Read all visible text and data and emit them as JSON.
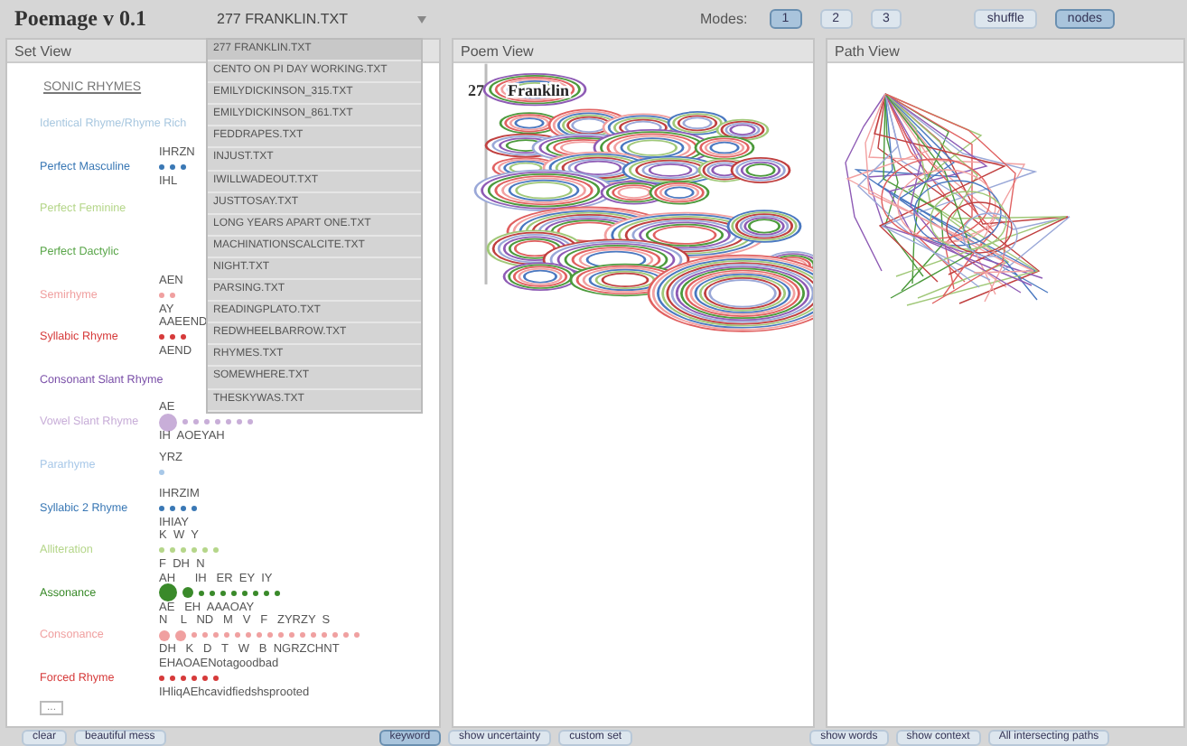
{
  "app": {
    "title": "Poemage v 0.1"
  },
  "file_select": {
    "value": "277 FRANKLIN.TXT",
    "options": [
      {
        "label": "277 FRANKLIN.TXT",
        "selected": true
      },
      {
        "label": "CENTO ON PI DAY WORKING.TXT",
        "selected": false
      },
      {
        "label": "EMILYDICKINSON_315.TXT",
        "selected": false
      },
      {
        "label": "EMILYDICKINSON_861.TXT",
        "selected": false
      },
      {
        "label": "FEDDRAPES.TXT",
        "selected": false
      },
      {
        "label": "INJUST.TXT",
        "selected": false
      },
      {
        "label": "IWILLWADEOUT.TXT",
        "selected": false
      },
      {
        "label": "JUSTTOSAY.TXT",
        "selected": false
      },
      {
        "label": "LONG YEARS APART ONE.TXT",
        "selected": false
      },
      {
        "label": "MACHINATIONSCALCITE.TXT",
        "selected": false
      },
      {
        "label": "NIGHT.TXT",
        "selected": false
      },
      {
        "label": "PARSING.TXT",
        "selected": false
      },
      {
        "label": "READINGPLATO.TXT",
        "selected": false
      },
      {
        "label": "REDWHEELBARROW.TXT",
        "selected": false
      },
      {
        "label": "RHYMES.TXT",
        "selected": false
      },
      {
        "label": "SOMEWHERE.TXT",
        "selected": false
      },
      {
        "label": "THESKYWAS.TXT",
        "selected": false
      }
    ]
  },
  "modes": {
    "label": "Modes:",
    "options": [
      {
        "label": "1",
        "selected": true
      },
      {
        "label": "2",
        "selected": false
      },
      {
        "label": "3",
        "selected": false
      }
    ]
  },
  "toggles": [
    {
      "label": "shuffle",
      "on": false
    },
    {
      "label": "nodes",
      "on": true
    }
  ],
  "set_view": {
    "title": "Set View",
    "heading": "SONIC RHYMES",
    "more": "...",
    "rhymes": [
      {
        "name": "Identical Rhyme/Rhyme Rich",
        "color": "#a9c8e0"
      },
      {
        "name": "Perfect Masculine",
        "color": "#3a78b5",
        "above": "IHRZN",
        "below": "IHL",
        "dots": [
          {
            "kind": "small"
          },
          {
            "kind": "small"
          },
          {
            "kind": "small"
          }
        ]
      },
      {
        "name": "Perfect Feminine",
        "color": "#b5d68a"
      },
      {
        "name": "Perfect Dactylic",
        "color": "#5aa64a"
      },
      {
        "name": "Semirhyme",
        "color": "#f0a0a0",
        "above": "AEN",
        "below": "AY",
        "dots": [
          {
            "kind": "small"
          },
          {
            "kind": "small"
          }
        ]
      },
      {
        "name": "Syllabic Rhyme",
        "color": "#d63a3a",
        "above": "AAEEND",
        "below": "AEND",
        "dots": [
          {
            "kind": "small"
          },
          {
            "kind": "small"
          },
          {
            "kind": "small"
          }
        ]
      },
      {
        "name": "Consonant Slant Rhyme",
        "color": "#7a4fa8"
      },
      {
        "name": "Vowel Slant Rhyme",
        "color": "#c8aed8",
        "above": "AE",
        "below": "IH  AOEYAH",
        "dots": [
          {
            "kind": "large"
          },
          {
            "kind": "small"
          },
          {
            "kind": "small"
          },
          {
            "kind": "small"
          },
          {
            "kind": "small"
          },
          {
            "kind": "small"
          },
          {
            "kind": "small"
          },
          {
            "kind": "small"
          }
        ]
      },
      {
        "name": "Pararhyme",
        "color": "#a8c8e8",
        "above": "YRZ",
        "dots": [
          {
            "kind": "small"
          }
        ]
      },
      {
        "name": "Syllabic 2 Rhyme",
        "color": "#3a78b5",
        "above": "IHRZIM",
        "below": "IHIAY",
        "dots": [
          {
            "kind": "small"
          },
          {
            "kind": "small"
          },
          {
            "kind": "small"
          },
          {
            "kind": "small"
          }
        ]
      },
      {
        "name": "Alliteration",
        "color": "#b5d68a",
        "above": "K  W  Y",
        "below": "F  DH  N",
        "dots": [
          {
            "kind": "small"
          },
          {
            "kind": "small"
          },
          {
            "kind": "small"
          },
          {
            "kind": "small"
          },
          {
            "kind": "small"
          },
          {
            "kind": "small"
          }
        ]
      },
      {
        "name": "Assonance",
        "color": "#3a8a2a",
        "above": "AH      IH   ER  EY  IY",
        "below": "AE   EH  AAAOAY",
        "dots": [
          {
            "kind": "large"
          },
          {
            "kind": "medium"
          },
          {
            "kind": "small"
          },
          {
            "kind": "small"
          },
          {
            "kind": "small"
          },
          {
            "kind": "small"
          },
          {
            "kind": "small"
          },
          {
            "kind": "small"
          },
          {
            "kind": "small"
          },
          {
            "kind": "small"
          }
        ]
      },
      {
        "name": "Consonance",
        "color": "#f0a0a0",
        "above": "N    L   ND   M   V   F   ZYRZY  S",
        "below": "DH   K   D   T   W   B  NGRZCHNT",
        "dots": [
          {
            "kind": "medium"
          },
          {
            "kind": "medium"
          },
          {
            "kind": "small"
          },
          {
            "kind": "small"
          },
          {
            "kind": "small"
          },
          {
            "kind": "small"
          },
          {
            "kind": "small"
          },
          {
            "kind": "small"
          },
          {
            "kind": "small"
          },
          {
            "kind": "small"
          },
          {
            "kind": "small"
          },
          {
            "kind": "small"
          },
          {
            "kind": "small"
          },
          {
            "kind": "small"
          },
          {
            "kind": "small"
          },
          {
            "kind": "small"
          },
          {
            "kind": "small"
          },
          {
            "kind": "small"
          }
        ]
      },
      {
        "name": "Forced Rhyme",
        "color": "#d63a3a",
        "above": "EHAOAENotagoodbad",
        "below": "IHliqAEhcavidfiedshsprooted",
        "dots": [
          {
            "kind": "small"
          },
          {
            "kind": "small"
          },
          {
            "kind": "small"
          },
          {
            "kind": "small"
          },
          {
            "kind": "small"
          },
          {
            "kind": "small"
          }
        ]
      }
    ]
  },
  "poem_view": {
    "title": "Poem View",
    "number": "27",
    "word": "Franklin"
  },
  "path_view": {
    "title": "Path View"
  },
  "bottom_buttons": [
    {
      "label": "clear",
      "selected": false
    },
    {
      "label": "beautiful mess",
      "selected": false
    },
    {
      "label": "keyword",
      "selected": true
    },
    {
      "label": "show uncertainty",
      "selected": false
    },
    {
      "label": "custom set",
      "selected": false
    },
    {
      "label": "show words",
      "selected": false
    },
    {
      "label": "show context",
      "selected": false
    },
    {
      "label": "All intersecting paths",
      "selected": false
    }
  ]
}
